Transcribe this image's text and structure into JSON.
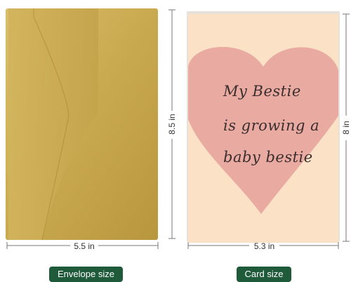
{
  "envelope": {
    "width_label": "5.5 in",
    "height_label": "8.5 in",
    "caption": "Envelope size",
    "color": "#c9a94f"
  },
  "card": {
    "width_label": "5.3 in",
    "height_label": "8 in",
    "caption": "Card size",
    "background_color": "#fbe1c5",
    "heart_color": "#e8aaa1",
    "message_lines": [
      "My Bestie",
      "is growing a",
      "baby bestie"
    ]
  },
  "caption_badge_color": "#1f5a3b"
}
